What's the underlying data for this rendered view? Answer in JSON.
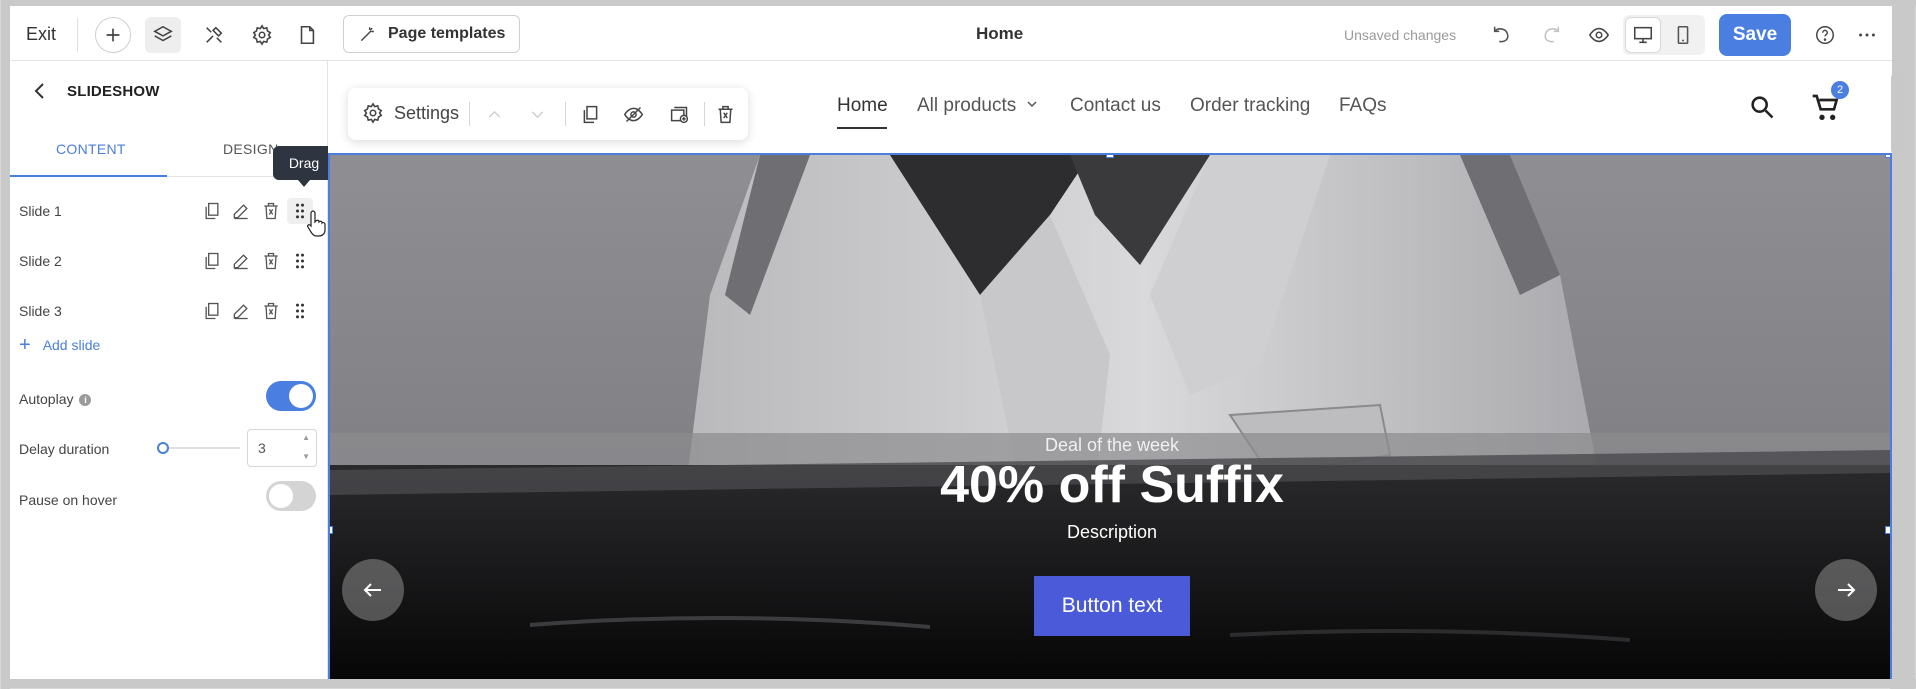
{
  "toolbar": {
    "exit_label": "Exit",
    "page_templates_label": "Page templates",
    "page_title": "Home",
    "unsaved_label": "Unsaved changes",
    "save_label": "Save"
  },
  "panel": {
    "title": "SLIDESHOW",
    "tabs": [
      "CONTENT",
      "DESIGN"
    ],
    "active_tab": "CONTENT",
    "slides": [
      {
        "label": "Slide 1"
      },
      {
        "label": "Slide 2"
      },
      {
        "label": "Slide 3"
      }
    ],
    "add_slide_label": "Add slide",
    "autoplay_label": "Autoplay",
    "autoplay_on": true,
    "delay_label": "Delay duration",
    "delay_value": "3",
    "pause_label": "Pause on hover",
    "pause_on": false,
    "tooltip": "Drag"
  },
  "site": {
    "nav": [
      {
        "label": "Home",
        "active": true
      },
      {
        "label": "All products",
        "dropdown": true
      },
      {
        "label": "Contact us"
      },
      {
        "label": "Order tracking"
      },
      {
        "label": "FAQs"
      }
    ],
    "cart_count": "2"
  },
  "floating_toolbar": {
    "settings_label": "Settings"
  },
  "hero": {
    "eyebrow": "Deal of the week",
    "title": "40% off Suffix",
    "description": "Description",
    "button_label": "Button text"
  },
  "colors": {
    "accent": "#4a7ee0",
    "hero_button": "#4a5ad9",
    "tooltip_bg": "#2f3540"
  }
}
